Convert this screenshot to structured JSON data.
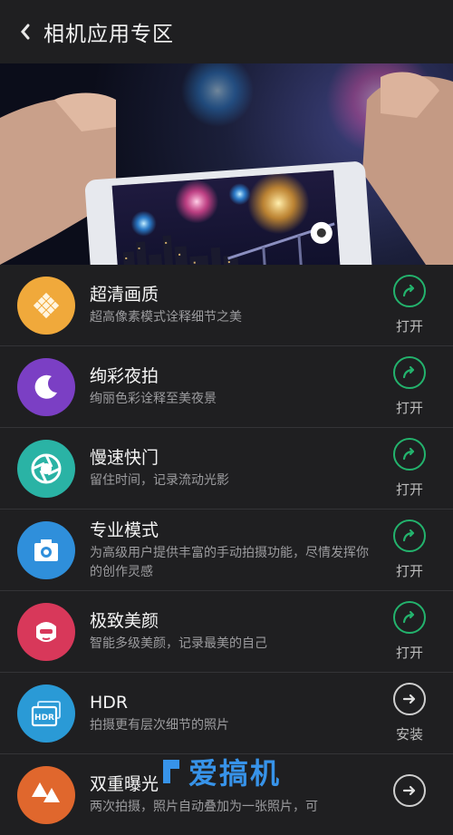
{
  "header": {
    "title": "相机应用专区"
  },
  "items": [
    {
      "name": "超清画质",
      "desc": "超高像素模式诠释细节之美",
      "action": "打开",
      "color": "#f0a93b",
      "icon": "grid-diamond-icon"
    },
    {
      "name": "绚彩夜拍",
      "desc": "绚丽色彩诠释至美夜景",
      "action": "打开",
      "color": "#7b3fc4",
      "icon": "moon-icon"
    },
    {
      "name": "慢速快门",
      "desc": "留住时间，记录流动光影",
      "action": "打开",
      "color": "#2ab3a5",
      "icon": "shutter-icon"
    },
    {
      "name": "专业模式",
      "desc": "为高级用户提供丰富的手动拍摄功能，尽情发挥你的创作灵感",
      "action": "打开",
      "color": "#2f8fdb",
      "icon": "camera-icon"
    },
    {
      "name": "极致美颜",
      "desc": "智能多级美颜，记录最美的自己",
      "action": "打开",
      "color": "#d8385a",
      "icon": "face-icon"
    },
    {
      "name": "HDR",
      "desc": "拍摄更有层次细节的照片",
      "action": "安装",
      "color": "#2a9ad6",
      "icon": "hdr-icon"
    },
    {
      "name": "双重曝光",
      "desc": "两次拍摄，照片自动叠加为一张照片，可",
      "action": "",
      "color": "#e0672d",
      "icon": "trees-icon"
    }
  ],
  "watermark": {
    "text": "爱搞机"
  }
}
